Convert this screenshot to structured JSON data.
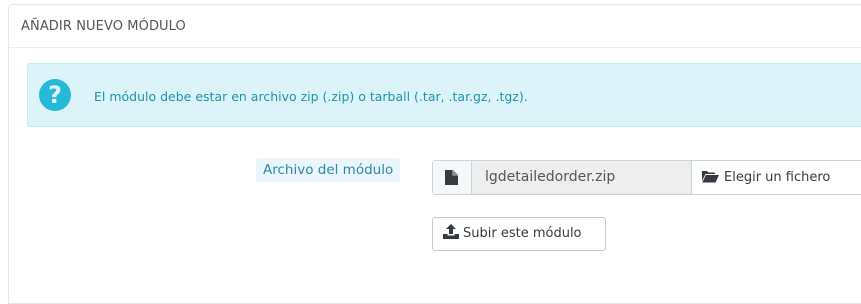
{
  "panel": {
    "title": "AÑADIR NUEVO MÓDULO"
  },
  "alert": {
    "icon": "question-icon",
    "message": "El módulo debe estar en archivo zip (.zip) o tarball (.tar, .tar.gz, .tgz).",
    "text_color": "#1e94ab",
    "background": "#dcf4f9"
  },
  "form": {
    "file_label": "Archivo del módulo",
    "file_icon": "file-icon",
    "file_name": "lgdetailedorder.zip",
    "choose_button_icon": "folder-open-icon",
    "choose_button_label": "Elegir un fichero",
    "upload_button_icon": "upload-icon",
    "upload_button_label": "Subir este módulo"
  },
  "colors": {
    "accent": "#25b9d7"
  }
}
